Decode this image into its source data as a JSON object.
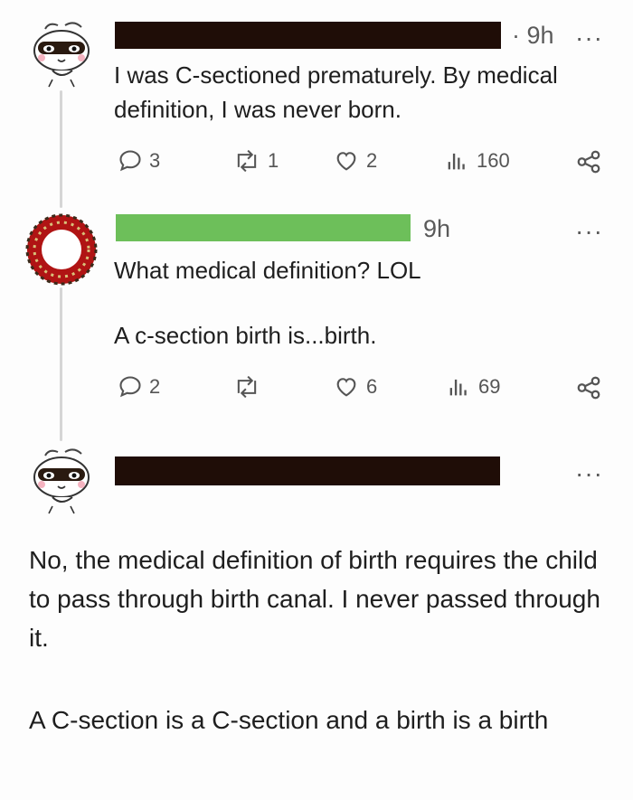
{
  "posts": [
    {
      "time": "· 9h",
      "more": "···",
      "text": [
        "I was C-sectioned prematurely. By medical definition, I was never born."
      ],
      "stats": {
        "replies": "3",
        "reposts": "1",
        "likes": "2",
        "views": "160"
      }
    },
    {
      "time": "9h",
      "more": "···",
      "text": [
        "What medical definition? LOL",
        "A c-section birth is...birth."
      ],
      "stats": {
        "replies": "2",
        "reposts": "",
        "likes": "6",
        "views": "69"
      }
    },
    {
      "more": "···",
      "text": [
        "No, the medical definition of birth requires the child to pass through birth canal. I never passed through it.",
        "A C-section is a C-section and a birth is a birth"
      ]
    }
  ],
  "icons": [
    "reply-icon",
    "repost-icon",
    "like-icon",
    "views-icon",
    "share-icon"
  ],
  "colors": {
    "redaction_black": "#1f0d07",
    "redaction_green": "#6dbf5a",
    "thread_line": "#d6d6d6"
  }
}
